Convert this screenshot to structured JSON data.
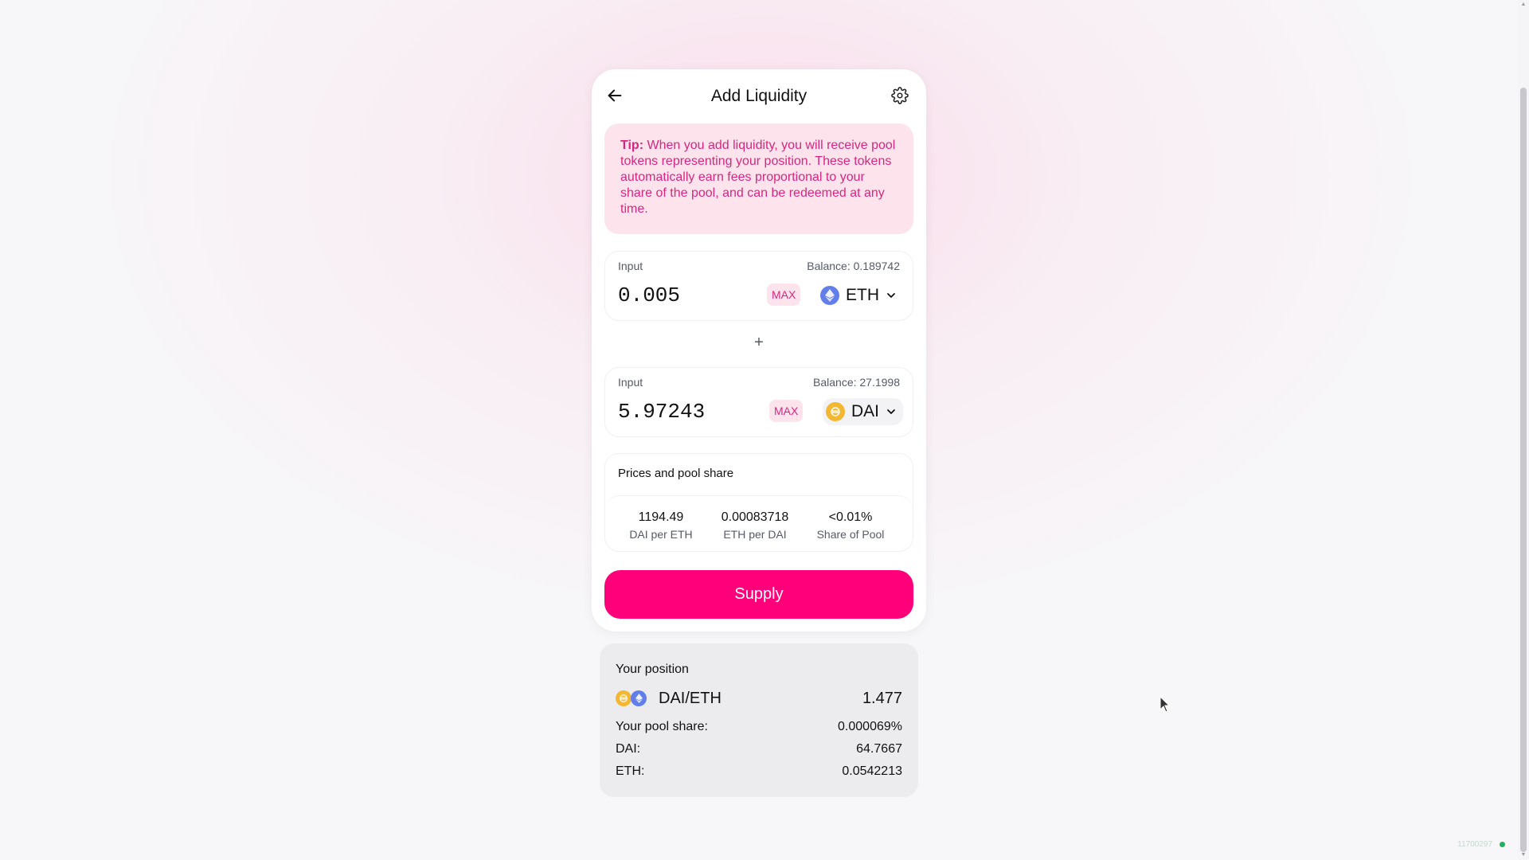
{
  "header": {
    "title": "Add Liquidity",
    "back_icon": "arrow-left-icon",
    "settings_icon": "gear-icon"
  },
  "tip": {
    "bold": "Tip:",
    "text": " When you add liquidity, you will receive pool tokens representing your position. These tokens automatically earn fees proportional to your share of the pool, and can be redeemed at any time."
  },
  "input_a": {
    "label": "Input",
    "balance": "Balance: 0.189742",
    "amount": "0.005",
    "max_label": "MAX",
    "token": "ETH",
    "token_icon": "eth-icon"
  },
  "plus": "+",
  "input_b": {
    "label": "Input",
    "balance": "Balance: 27.1998",
    "amount": "5.97243",
    "max_label": "MAX",
    "token": "DAI",
    "token_icon": "dai-icon"
  },
  "prices": {
    "title": "Prices and pool share",
    "items": [
      {
        "value": "1194.49",
        "label": "DAI per ETH"
      },
      {
        "value": "0.00083718",
        "label": "ETH per DAI"
      },
      {
        "value": "<0.01%",
        "label": "Share of Pool"
      }
    ]
  },
  "supply_label": "Supply",
  "position": {
    "title": "Your position",
    "pair": "DAI/ETH",
    "pair_value": "1.477",
    "rows": [
      {
        "label": "Your pool share:",
        "value": "0.000069%"
      },
      {
        "label": "DAI:",
        "value": "64.7667"
      },
      {
        "label": "ETH:",
        "value": "0.0542213"
      }
    ]
  },
  "status": {
    "text": "11700297"
  },
  "colors": {
    "accent": "#ff007a",
    "accent_text": "#d6277f",
    "tip_bg": "#fde3ec",
    "eth": "#627eea",
    "dai": "#f4b731"
  }
}
